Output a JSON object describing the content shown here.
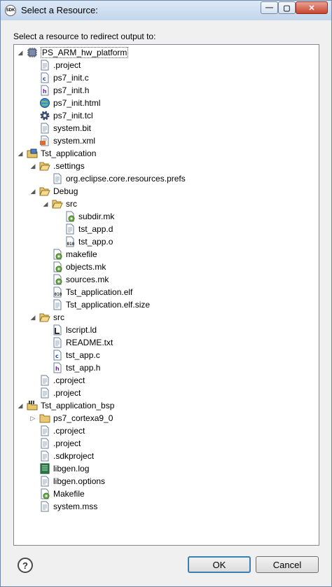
{
  "window": {
    "title": "Select a Resource:",
    "app_icon_text": "SDK"
  },
  "prompt": "Select a resource to redirect output to:",
  "tree": [
    {
      "label": "PS_ARM_hw_platform",
      "depth": 0,
      "twisty": "expanded",
      "icon": "hw-project",
      "selected": true
    },
    {
      "label": ".project",
      "depth": 1,
      "icon": "file"
    },
    {
      "label": "ps7_init.c",
      "depth": 1,
      "icon": "c-source"
    },
    {
      "label": "ps7_init.h",
      "depth": 1,
      "icon": "c-header"
    },
    {
      "label": "ps7_init.html",
      "depth": 1,
      "icon": "web-globe"
    },
    {
      "label": "ps7_init.tcl",
      "depth": 1,
      "icon": "gear"
    },
    {
      "label": "system.bit",
      "depth": 1,
      "icon": "file"
    },
    {
      "label": "system.xml",
      "depth": 1,
      "icon": "xml"
    },
    {
      "label": "Tst_application",
      "depth": 0,
      "twisty": "expanded",
      "icon": "app-project"
    },
    {
      "label": ".settings",
      "depth": 1,
      "twisty": "expanded",
      "icon": "folder-open"
    },
    {
      "label": "org.eclipse.core.resources.prefs",
      "depth": 2,
      "icon": "file"
    },
    {
      "label": "Debug",
      "depth": 1,
      "twisty": "expanded",
      "icon": "folder-open"
    },
    {
      "label": "src",
      "depth": 2,
      "twisty": "expanded",
      "icon": "folder-open"
    },
    {
      "label": "subdir.mk",
      "depth": 3,
      "icon": "makefile"
    },
    {
      "label": "tst_app.d",
      "depth": 3,
      "icon": "file"
    },
    {
      "label": "tst_app.o",
      "depth": 3,
      "icon": "binary"
    },
    {
      "label": "makefile",
      "depth": 2,
      "icon": "makefile"
    },
    {
      "label": "objects.mk",
      "depth": 2,
      "icon": "makefile"
    },
    {
      "label": "sources.mk",
      "depth": 2,
      "icon": "makefile"
    },
    {
      "label": "Tst_application.elf",
      "depth": 2,
      "icon": "binary"
    },
    {
      "label": "Tst_application.elf.size",
      "depth": 2,
      "icon": "file"
    },
    {
      "label": "src",
      "depth": 1,
      "twisty": "expanded",
      "icon": "folder-open"
    },
    {
      "label": "lscript.ld",
      "depth": 2,
      "icon": "linker"
    },
    {
      "label": "README.txt",
      "depth": 2,
      "icon": "file"
    },
    {
      "label": "tst_app.c",
      "depth": 2,
      "icon": "c-source"
    },
    {
      "label": "tst_app.h",
      "depth": 2,
      "icon": "c-header"
    },
    {
      "label": ".cproject",
      "depth": 1,
      "icon": "file"
    },
    {
      "label": ".project",
      "depth": 1,
      "icon": "file"
    },
    {
      "label": "Tst_application_bsp",
      "depth": 0,
      "twisty": "expanded",
      "icon": "bsp-project"
    },
    {
      "label": "ps7_cortexa9_0",
      "depth": 1,
      "twisty": "collapsed",
      "icon": "folder-closed"
    },
    {
      "label": ".cproject",
      "depth": 1,
      "icon": "file"
    },
    {
      "label": ".project",
      "depth": 1,
      "icon": "file"
    },
    {
      "label": ".sdkproject",
      "depth": 1,
      "icon": "file"
    },
    {
      "label": "libgen.log",
      "depth": 1,
      "icon": "log"
    },
    {
      "label": "libgen.options",
      "depth": 1,
      "icon": "file"
    },
    {
      "label": "Makefile",
      "depth": 1,
      "icon": "makefile"
    },
    {
      "label": "system.mss",
      "depth": 1,
      "icon": "file"
    }
  ],
  "buttons": {
    "help": "?",
    "ok": "OK",
    "cancel": "Cancel"
  },
  "window_controls": {
    "minimize": "—",
    "maximize": "▢",
    "close": "✕"
  }
}
